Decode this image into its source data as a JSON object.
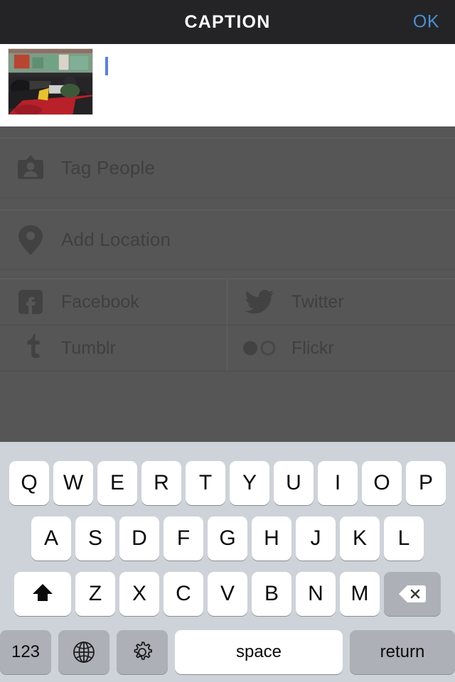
{
  "header": {
    "title": "CAPTION",
    "ok_label": "OK",
    "ok_color": "#4a8fd4",
    "background": "#242426"
  },
  "caption": {
    "value": "",
    "placeholder": "",
    "caret_color": "#5b7fe8",
    "thumbnail_alt": "race cars in a garage"
  },
  "options": {
    "background": "#565656",
    "rows": [
      {
        "label": "Tag People",
        "icon": "person-badge-icon"
      },
      {
        "label": "Add Location",
        "icon": "map-pin-icon"
      }
    ],
    "social": [
      {
        "label": "Facebook",
        "icon": "facebook-icon"
      },
      {
        "label": "Twitter",
        "icon": "twitter-icon"
      },
      {
        "label": "Tumblr",
        "icon": "tumblr-icon"
      },
      {
        "label": "Flickr",
        "icon": "flickr-icon"
      }
    ]
  },
  "keyboard": {
    "background": "#ced2d9",
    "row1": [
      "Q",
      "W",
      "E",
      "R",
      "T",
      "Y",
      "U",
      "I",
      "O",
      "P"
    ],
    "row2": [
      "A",
      "S",
      "D",
      "F",
      "G",
      "H",
      "J",
      "K",
      "L"
    ],
    "row3": [
      "Z",
      "X",
      "C",
      "V",
      "B",
      "N",
      "M"
    ],
    "shift_icon": "shift-arrow-icon",
    "backspace_icon": "backspace-icon",
    "numbers_label": "123",
    "globe_icon": "globe-icon",
    "gear_icon": "gear-icon",
    "space_label": "space",
    "return_label": "return"
  }
}
